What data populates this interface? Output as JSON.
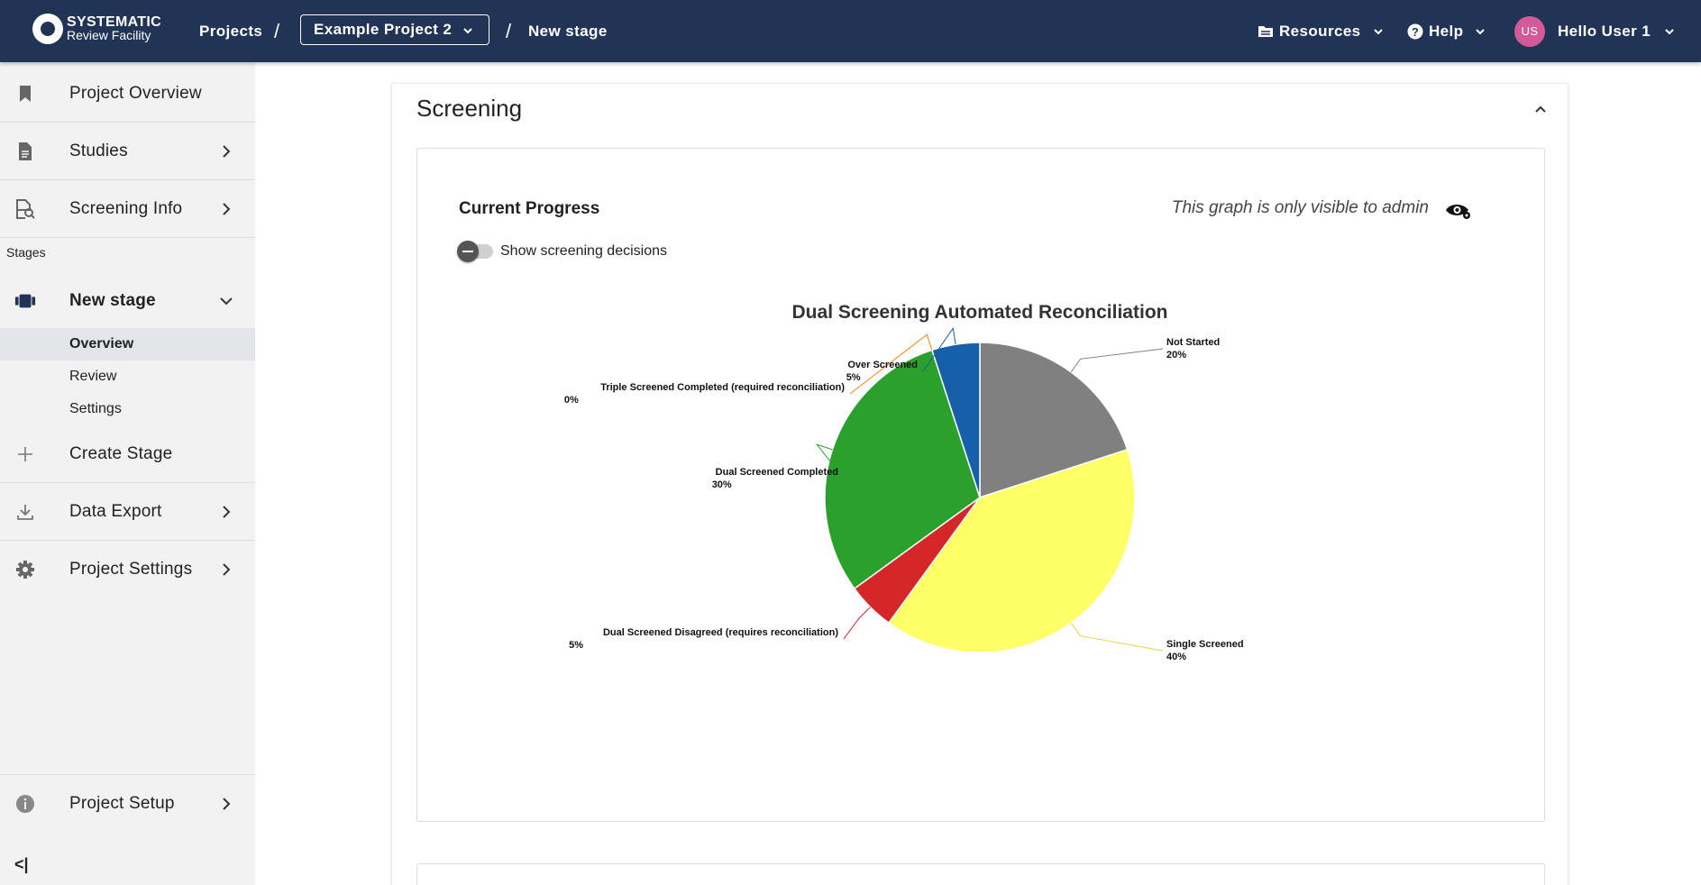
{
  "header": {
    "logo_line1": "SYSTEMATIC",
    "logo_line2": "Review Facility",
    "projects": "Projects",
    "sep": "/",
    "project_name": "Example Project 2",
    "stage": "New stage",
    "resources": "Resources",
    "help": "Help",
    "avatar_initials": "US",
    "greeting": "Hello User 1"
  },
  "sidebar": {
    "items": [
      {
        "label": "Project Overview",
        "icon": "bookmark-icon"
      },
      {
        "label": "Studies",
        "icon": "document-icon"
      },
      {
        "label": "Screening Info",
        "icon": "document-search-icon"
      }
    ],
    "stages_label": "Stages",
    "stage": {
      "label": "New stage",
      "icon": "stage-icon"
    },
    "sub_items": [
      "Overview",
      "Review",
      "Settings"
    ],
    "create_stage": "Create Stage",
    "data_export": "Data Export",
    "project_settings": "Project Settings",
    "project_setup": "Project Setup",
    "collapse": "<|"
  },
  "main": {
    "section_title": "Screening",
    "progress_title": "Current Progress",
    "admin_note": "This graph is only visible to admin",
    "toggle_label": "Show screening decisions"
  },
  "chart_data": {
    "type": "pie",
    "title": "Dual Screening Automated Reconciliation",
    "slices": [
      {
        "name": "Not Started",
        "value": 20,
        "label": "20%",
        "color": "#808080"
      },
      {
        "name": "Single Screened",
        "value": 40,
        "label": "40%",
        "color": "#ffff66"
      },
      {
        "name": "Dual Screened Disagreed (requires reconciliation)",
        "value": 5,
        "label": "5%",
        "color": "#d62728"
      },
      {
        "name": "Dual Screened Completed",
        "value": 30,
        "label": "30%",
        "color": "#2ca02c"
      },
      {
        "name": "Triple Screened Completed (required reconciliation)",
        "value": 0,
        "label": "0%",
        "color": "#ff7f0e"
      },
      {
        "name": "Over Screened",
        "value": 5,
        "label": "5%",
        "color": "#1560a8"
      }
    ],
    "legend": [
      "Not Started",
      "Single Screened",
      "Dual Screened Disagreed (requires reconciliation)",
      "Dual Screened Completed",
      "Triple Screened Completed (required reconciliation)",
      "Over Screened"
    ],
    "legend_position": "bottom"
  }
}
